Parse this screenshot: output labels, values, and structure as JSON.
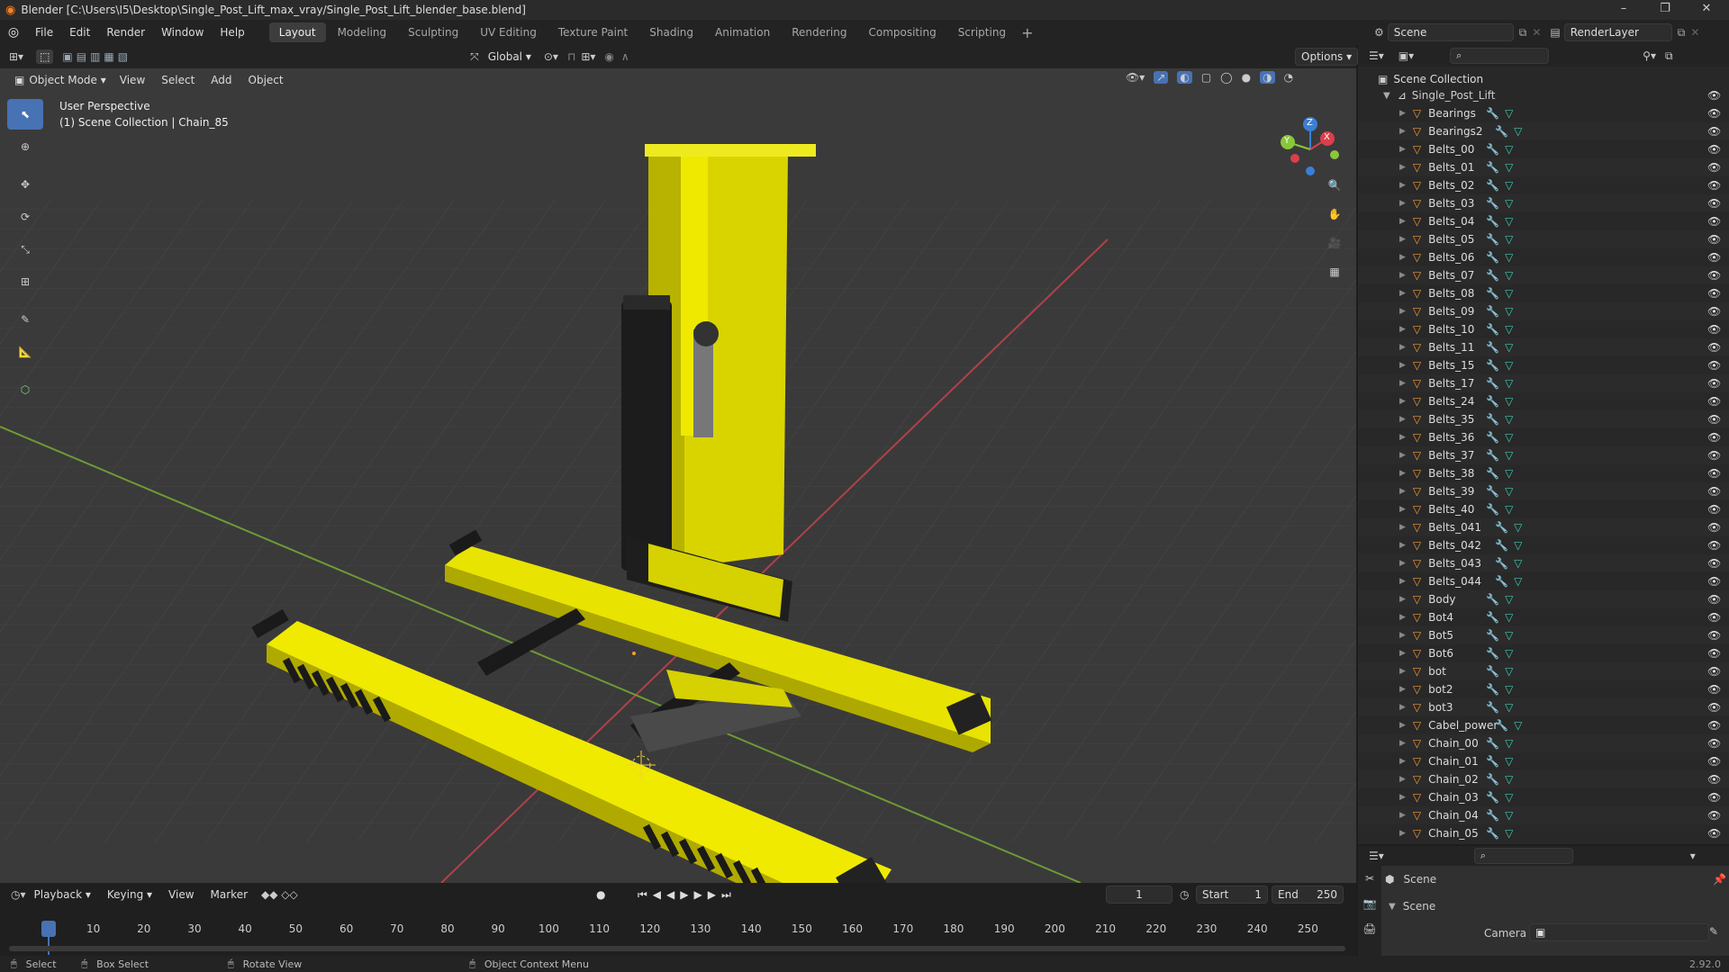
{
  "window": {
    "title": "Blender [C:\\Users\\I5\\Desktop\\Single_Post_Lift_max_vray/Single_Post_Lift_blender_base.blend]"
  },
  "menu": [
    "File",
    "Edit",
    "Render",
    "Window",
    "Help"
  ],
  "workspaces": [
    "Layout",
    "Modeling",
    "Sculpting",
    "UV Editing",
    "Texture Paint",
    "Shading",
    "Animation",
    "Rendering",
    "Compositing",
    "Scripting"
  ],
  "active_workspace": "Layout",
  "scene_field": "Scene",
  "view_layer_field": "RenderLayer",
  "viewport": {
    "mode": "Object Mode",
    "menus": [
      "View",
      "Select",
      "Add",
      "Object"
    ],
    "transform_orientation": "Global",
    "options": "Options",
    "info_line1": "User Perspective",
    "info_line2": "(1) Scene Collection | Chain_85",
    "gizmo_axes": [
      "Z",
      "X",
      "Y"
    ]
  },
  "outliner": {
    "root": "Scene Collection",
    "collection": "Single_Post_Lift",
    "items": [
      "Bearings",
      "Bearings2",
      "Belts_00",
      "Belts_01",
      "Belts_02",
      "Belts_03",
      "Belts_04",
      "Belts_05",
      "Belts_06",
      "Belts_07",
      "Belts_08",
      "Belts_09",
      "Belts_10",
      "Belts_11",
      "Belts_15",
      "Belts_17",
      "Belts_24",
      "Belts_35",
      "Belts_36",
      "Belts_37",
      "Belts_38",
      "Belts_39",
      "Belts_40",
      "Belts_041",
      "Belts_042",
      "Belts_043",
      "Belts_044",
      "Body",
      "Bot4",
      "Bot5",
      "Bot6",
      "bot",
      "bot2",
      "bot3",
      "Cabel_power",
      "Chain_00",
      "Chain_01",
      "Chain_02",
      "Chain_03",
      "Chain_04",
      "Chain_05"
    ]
  },
  "properties": {
    "title": "Scene",
    "section": "Scene",
    "camera_label": "Camera"
  },
  "timeline": {
    "menus": [
      "Playback",
      "Keying",
      "View",
      "Marker"
    ],
    "current_frame": "1",
    "start_label": "Start",
    "start": "1",
    "end_label": "End",
    "end": "250",
    "ticks": [
      "1",
      "10",
      "20",
      "30",
      "40",
      "50",
      "60",
      "70",
      "80",
      "90",
      "100",
      "110",
      "120",
      "130",
      "140",
      "150",
      "160",
      "170",
      "180",
      "190",
      "200",
      "210",
      "220",
      "230",
      "240",
      "250"
    ]
  },
  "status": {
    "select": "Select",
    "box_select": "Box Select",
    "rotate": "Rotate View",
    "context": "Object Context Menu",
    "version": "2.92.0"
  },
  "colors": {
    "accent": "#4772b3",
    "yellow": "#e8e000",
    "x_axis": "#d9404b",
    "y_axis": "#8ac63a",
    "z_axis": "#3a7fd6"
  }
}
